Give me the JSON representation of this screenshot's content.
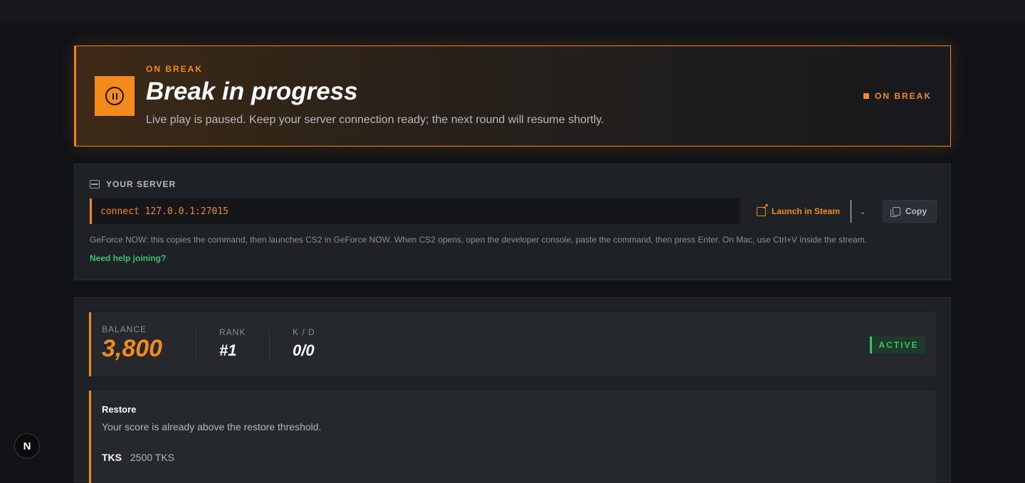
{
  "banner": {
    "kicker": "ON BREAK",
    "title": "Break in progress",
    "description": "Live play is paused. Keep your server connection ready; the next round will resume shortly.",
    "status": "ON BREAK",
    "icon": "pause-circle-icon",
    "accent_color": "#f38a1b"
  },
  "server": {
    "heading": "YOUR SERVER",
    "connect_command": "connect 127.0.0.1:27015",
    "launch_label": "Launch in Steam",
    "copy_label": "Copy",
    "note": "GeForce NOW: this copies the command, then launches CS2 in GeForce NOW. When CS2 opens, open the developer console, paste the command, then press Enter. On Mac, use Ctrl+V inside the stream.",
    "help_link": "Need help joining?",
    "help_color": "#34c46b"
  },
  "stats": {
    "balance_label": "BALANCE",
    "balance_value": "3,800",
    "rank_label": "RANK",
    "rank_value": "#1",
    "kd_label": "K / D",
    "kd_value": "0/0",
    "status_badge": "ACTIVE"
  },
  "restore": {
    "title": "Restore",
    "description": "Your score is already above the restore threshold.",
    "tks_label": "TKS",
    "tks_value": "2500 TKS"
  },
  "fab_label": "N"
}
